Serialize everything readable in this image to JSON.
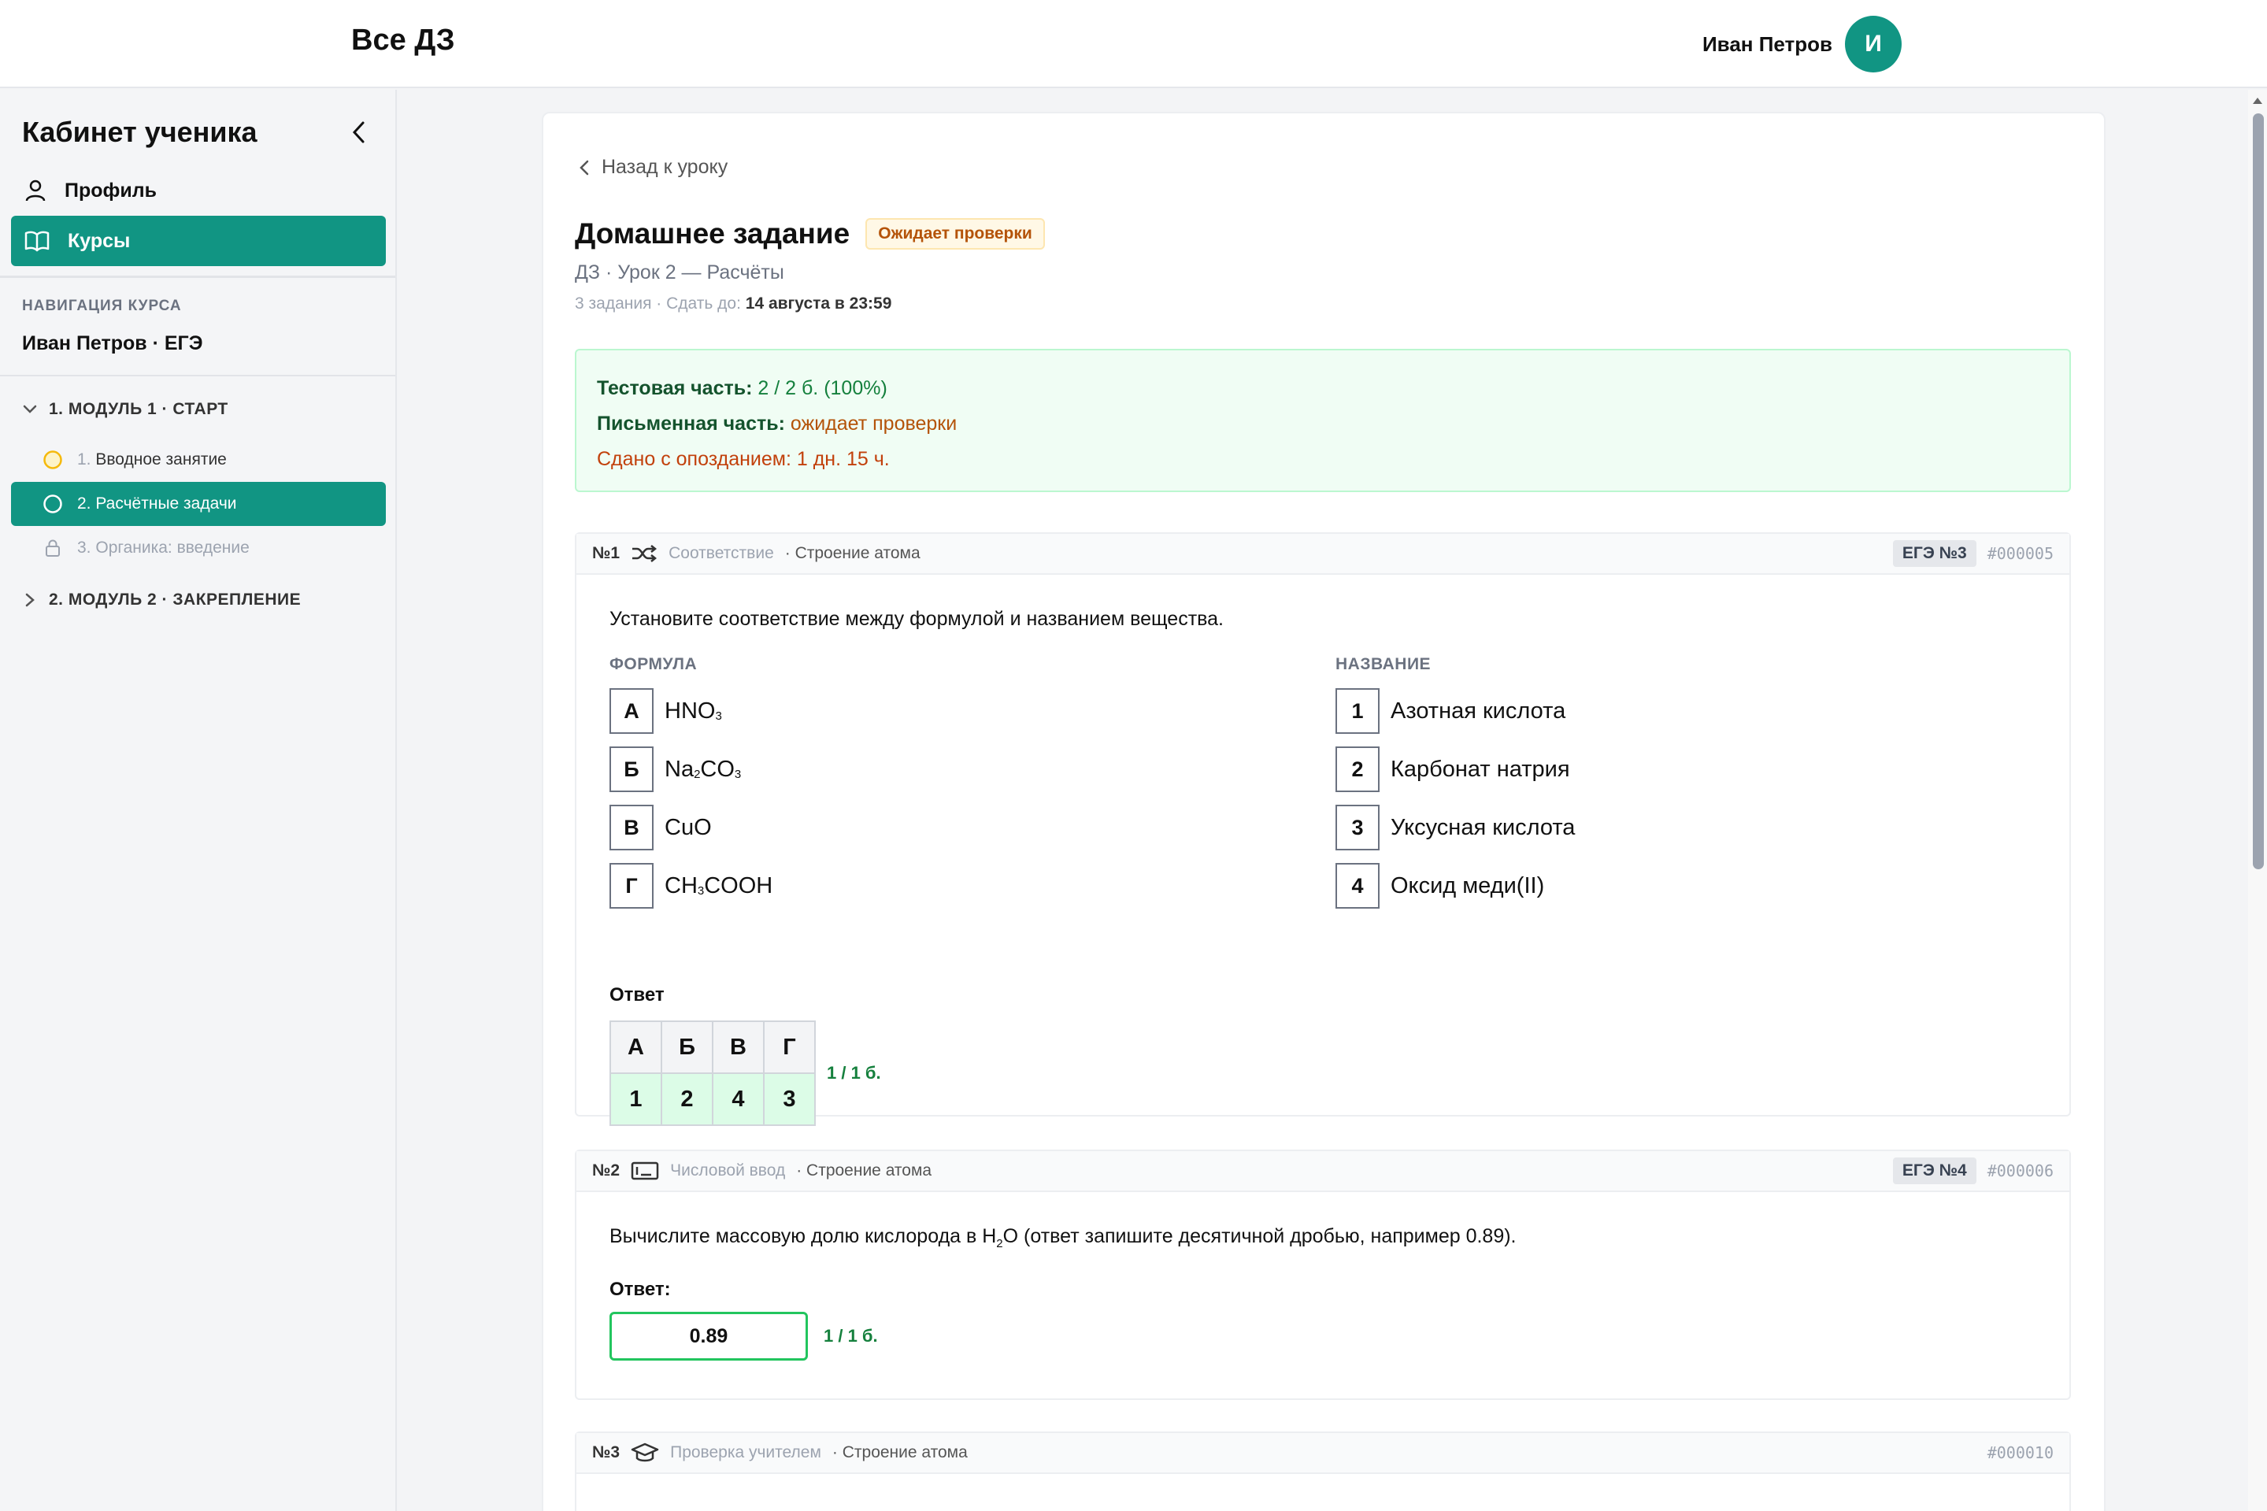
{
  "header": {
    "title": "Все ДЗ",
    "user_name": "Иван Петров",
    "avatar_letter": "И"
  },
  "sidebar": {
    "title": "Кабинет ученика",
    "menu": [
      {
        "label": "Профиль",
        "icon": "user-icon",
        "active": false
      },
      {
        "label": "Курсы",
        "icon": "book-icon",
        "active": true
      }
    ],
    "section_label": "НАВИГАЦИЯ КУРСА",
    "course_name": "Иван Петров · ЕГЭ",
    "modules": [
      {
        "label": "1. МОДУЛЬ 1 · СТАРТ",
        "expanded": true,
        "lessons": [
          {
            "num": "1.",
            "label": "Вводное занятие",
            "state": "in-progress"
          },
          {
            "num": "2.",
            "label": "Расчётные задачи",
            "state": "active"
          },
          {
            "num": "3.",
            "label": "Органика: введение",
            "state": "locked"
          }
        ]
      },
      {
        "label": "2. МОДУЛЬ 2 · ЗАКРЕПЛЕНИЕ",
        "expanded": false
      }
    ]
  },
  "homework": {
    "back_label": "Назад к уроку",
    "title": "Домашнее задание",
    "status_badge": "Ожидает проверки",
    "subtitle": "ДЗ · Урок 2 — Расчёты",
    "meta_prefix": "3 задания · Сдать до:",
    "deadline": "14 августа в 23:59",
    "summary": {
      "test_label": "Тестовая часть:",
      "test_value": "2 / 2 б. (100%)",
      "written_label": "Письменная часть:",
      "written_value": "ожидает проверки",
      "late": "Сдано с опозданием: 1 дн. 15 ч."
    }
  },
  "tasks": [
    {
      "number": "№1",
      "kind": "Соответствие",
      "topic": "· Строение атома",
      "ege": "ЕГЭ №3",
      "id": "#000005",
      "question": "Установите соответствие между формулой и названием вещества.",
      "left_label": "ФОРМУЛА",
      "right_label": "НАЗВАНИЕ",
      "left_keys": [
        "А",
        "Б",
        "В",
        "Г"
      ],
      "right": [
        {
          "key": "1",
          "label": "Азотная кислота"
        },
        {
          "key": "2",
          "label": "Карбонат натрия"
        },
        {
          "key": "3",
          "label": "Уксусная кислота"
        },
        {
          "key": "4",
          "label": "Оксид меди(II)"
        }
      ],
      "answer_label": "Ответ",
      "answer_head": [
        "А",
        "Б",
        "В",
        "Г"
      ],
      "answer_values": [
        "1",
        "2",
        "4",
        "3"
      ],
      "score": "1 / 1 б."
    },
    {
      "number": "№2",
      "kind": "Числовой ввод",
      "topic": "· Строение атома",
      "ege": "ЕГЭ №4",
      "id": "#000006",
      "question_pre": "Вычислите массовую долю кислорода в H",
      "question_sub": "2",
      "question_post": "O (ответ запишите десятичной дробью, например 0.89).",
      "answer_label": "Ответ:",
      "answer_value": "0.89",
      "score": "1 / 1 б."
    },
    {
      "number": "№3",
      "kind": "Проверка учителем",
      "topic": "· Строение атома",
      "id": "#000010"
    }
  ],
  "colors": {
    "accent": "#119583",
    "success": "#15803d",
    "warning": "#b45309",
    "late": "#c2410c"
  }
}
